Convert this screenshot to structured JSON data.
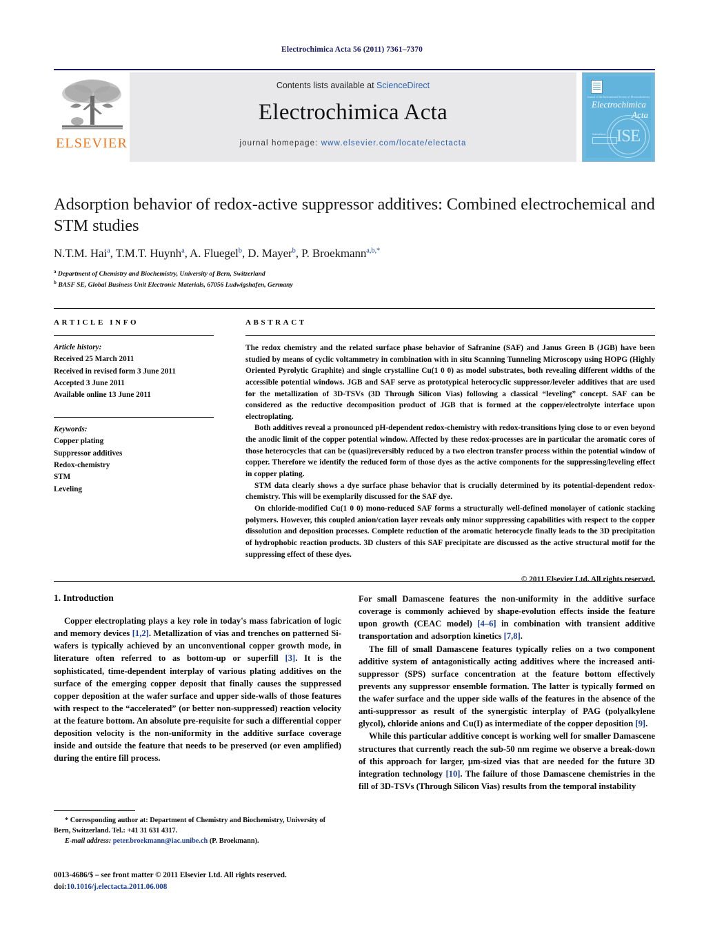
{
  "running_head": "Electrochimica Acta 56 (2011) 7361–7370",
  "masthead": {
    "elsevier_wordmark": "ELSEVIER",
    "contents_prefix": "Contents lists available at ",
    "sciencedirect": "ScienceDirect",
    "journal_name": "Electrochimica Acta",
    "homepage_prefix": "journal homepage: ",
    "homepage_url": "www.elsevier.com/locate/electacta",
    "cover": {
      "tiny_line": "Journal of the International Society of Electrochemistry",
      "title_line1": "Electrochimica",
      "title_line2": "Acta",
      "boxlet_label": "ScienceDirect",
      "seal_text": "ISE"
    }
  },
  "article": {
    "title": "Adsorption behavior of redox-active suppressor additives: Combined electrochemical and STM studies",
    "authors": [
      {
        "name": "N.T.M. Hai",
        "marks": "a"
      },
      {
        "name": "T.M.T. Huynh",
        "marks": "a"
      },
      {
        "name": "A. Fluegel",
        "marks": "b"
      },
      {
        "name": "D. Mayer",
        "marks": "b"
      },
      {
        "name": "P. Broekmann",
        "marks": "a,b,*"
      }
    ],
    "affiliations": [
      {
        "mark": "a",
        "text": "Department of Chemistry and Biochemistry, University of Bern, Switzerland"
      },
      {
        "mark": "b",
        "text": "BASF SE, Global Business Unit Electronic Materials, 67056 Ludwigshafen, Germany"
      }
    ]
  },
  "article_info": {
    "heading": "ARTICLE INFO",
    "history_label": "Article history:",
    "history": [
      "Received 25 March 2011",
      "Received in revised form 3 June 2011",
      "Accepted 3 June 2011",
      "Available online 13 June 2011"
    ],
    "keywords_label": "Keywords:",
    "keywords": [
      "Copper plating",
      "Suppressor additives",
      "Redox-chemistry",
      "STM",
      "Leveling"
    ]
  },
  "abstract": {
    "heading": "ABSTRACT",
    "paragraphs": [
      "The redox chemistry and the related surface phase behavior of Safranine (SAF) and Janus Green B (JGB) have been studied by means of cyclic voltammetry in combination with in situ Scanning Tunneling Microscopy using HOPG (Highly Oriented Pyrolytic Graphite) and single crystalline Cu(1 0 0) as model substrates, both revealing different widths of the accessible potential windows. JGB and SAF serve as prototypical heterocyclic suppressor/leveler additives that are used for the metallization of 3D-TSVs (3D Through Silicon Vias) following a classical “leveling” concept. SAF can be considered as the reductive decomposition product of JGB that is formed at the copper/electrolyte interface upon electroplating.",
      "Both additives reveal a pronounced pH-dependent redox-chemistry with redox-transitions lying close to or even beyond the anodic limit of the copper potential window. Affected by these redox-processes are in particular the aromatic cores of those heterocycles that can be (quasi)reversibly reduced by a two electron transfer process within the potential window of copper. Therefore we identify the reduced form of those dyes as the active components for the suppressing/leveling effect in copper plating.",
      "STM data clearly shows a dye surface phase behavior that is crucially determined by its potential-dependent redox-chemistry. This will be exemplarily discussed for the SAF dye.",
      "On chloride-modified Cu(1 0 0) mono-reduced SAF forms a structurally well-defined monolayer of cationic stacking polymers. However, this coupled anion/cation layer reveals only minor suppressing capabilities with respect to the copper dissolution and deposition processes. Complete reduction of the aromatic heterocycle finally leads to the 3D precipitation of hydrophobic reaction products. 3D clusters of this SAF precipitate are discussed as the active structural motif for the suppressing effect of these dyes."
    ],
    "copyright": "© 2011 Elsevier Ltd. All rights reserved."
  },
  "introduction": {
    "heading": "1. Introduction",
    "left_paragraphs": [
      "Copper electroplating plays a key role in today's mass fabrication of logic and memory devices [1,2]. Metallization of vias and trenches on patterned Si-wafers is typically achieved by an unconventional copper growth mode, in literature often referred to as bottom-up or superfill [3]. It is the sophisticated, time-dependent interplay of various plating additives on the surface of the emerging copper deposit that finally causes the suppressed copper deposition at the wafer surface and upper side-walls of those features with respect to the “accelerated” (or better non-suppressed) reaction velocity at the feature bottom. An absolute pre-requisite for such a differential copper deposition velocity is the non-uniformity in the additive surface coverage inside and outside the feature that needs to be preserved (or even amplified) during the entire fill process."
    ],
    "right_paragraphs": [
      "For small Damascene features the non-uniformity in the additive surface coverage is commonly achieved by shape-evolution effects inside the feature upon growth (CEAC model) [4–6] in combination with transient additive transportation and adsorption kinetics [7,8].",
      "The fill of small Damascene features typically relies on a two component additive system of antagonistically acting additives where the increased anti-suppressor (SPS) surface concentration at the feature bottom effectively prevents any suppressor ensemble formation. The latter is typically formed on the wafer surface and the upper side walls of the features in the absence of the anti-suppressor as result of the synergistic interplay of PAG (polyalkylene glycol), chloride anions and Cu(I) as intermediate of the copper deposition [9].",
      "While this particular additive concept is working well for smaller Damascene structures that currently reach the sub-50 nm regime we observe a break-down of this approach for larger, μm-sized vias that are needed for the future 3D integration technology [10]. The failure of those Damascene chemistries in the fill of 3D-TSVs (Through Silicon Vias) results from the temporal instability"
    ]
  },
  "footnotes": {
    "corresponding": "* Corresponding author at: Department of Chemistry and Biochemistry, University of Bern, Switzerland. Tel.: +41 31 631 4317.",
    "email_label": "E-mail address:",
    "email": "peter.broekmann@iac.unibe.ch",
    "email_suffix": "(P. Broekmann)."
  },
  "imprint": {
    "line1": "0013-4686/$ – see front matter © 2011 Elsevier Ltd. All rights reserved.",
    "doi_label": "doi:",
    "doi": "10.1016/j.electacta.2011.06.008"
  },
  "colors": {
    "header_navy": "#1b1b60",
    "link_blue": "#2b5fa8",
    "ref_blue": "#1b3f8f",
    "elsevier_orange": "#E87722",
    "band_gray": "#e8e8ea",
    "cover_blue": "#63b4dd"
  }
}
